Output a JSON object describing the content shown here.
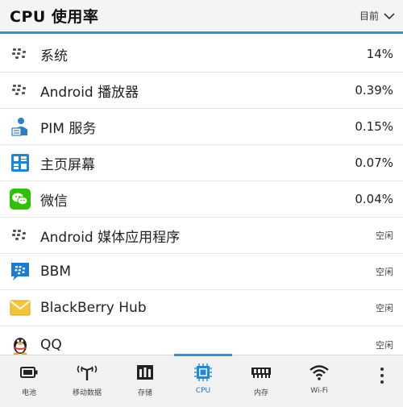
{
  "header": {
    "title": "CPU 使用率",
    "filter_label": "目前"
  },
  "apps": [
    {
      "icon": "blackberry-dots-icon",
      "name": "系统",
      "usage": "14%"
    },
    {
      "icon": "blackberry-dots-icon",
      "name": "Android 播放器",
      "usage": "0.39%"
    },
    {
      "icon": "pim-service-icon",
      "name": "PIM 服务",
      "usage": "0.15%"
    },
    {
      "icon": "home-screen-grid-icon",
      "name": "主页屏幕",
      "usage": "0.07%"
    },
    {
      "icon": "wechat-icon",
      "name": "微信",
      "usage": "0.04%"
    },
    {
      "icon": "blackberry-dots-icon",
      "name": "Android 媒体应用程序",
      "usage": "空闲"
    },
    {
      "icon": "bbm-icon",
      "name": "BBM",
      "usage": "空闲"
    },
    {
      "icon": "blackberry-hub-icon",
      "name": "BlackBerry Hub",
      "usage": "空闲"
    },
    {
      "icon": "qq-penguin-icon",
      "name": "QQ",
      "usage": "空闲"
    }
  ],
  "tabs": [
    {
      "icon": "battery-icon",
      "label": "电池"
    },
    {
      "icon": "mobile-data-antenna-icon",
      "label": "移动数据"
    },
    {
      "icon": "storage-icon",
      "label": "存储"
    },
    {
      "icon": "cpu-chip-icon",
      "label": "CPU",
      "active": true
    },
    {
      "icon": "memory-icon",
      "label": "内存"
    },
    {
      "icon": "wifi-icon",
      "label": "Wi-Fi"
    }
  ],
  "colors": {
    "accent": "#2d94d8",
    "wechat": "#2dc100",
    "bbm": "#1e7bd3"
  }
}
